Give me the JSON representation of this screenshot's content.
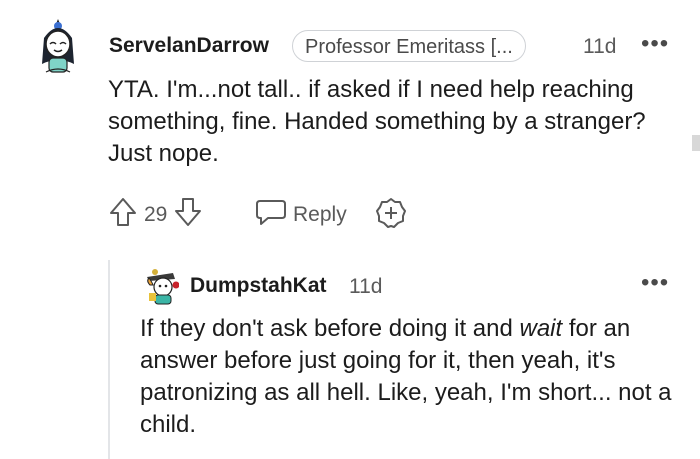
{
  "comment": {
    "author": "ServelanDarrow",
    "flair": "Professor Emeritass [...",
    "age": "11d",
    "more": "•••",
    "body": "YTA. I'm...not tall.. if asked if I need help reaching something, fine. Handed something by a stranger? Just nope.",
    "vote_count": "29",
    "reply_label": "Reply"
  },
  "reply": {
    "author": "DumpstahKat",
    "age": "11d",
    "more": "•••",
    "body_part1": "If they don't ask before doing it and ",
    "body_emph": "wait",
    "body_part2": " for an answer before just going for it, then yeah, it's patronizing as all hell. Like, yeah, I'm short... not a child."
  },
  "colors": {
    "text": "#1c1c1c",
    "meta": "#5a5a5a",
    "border": "#cfd2d6",
    "thread_line": "#e3e5e8"
  },
  "icons": [
    "avatar",
    "upvote-icon",
    "downvote-icon",
    "reply-icon",
    "award-icon",
    "more-options-icon"
  ]
}
